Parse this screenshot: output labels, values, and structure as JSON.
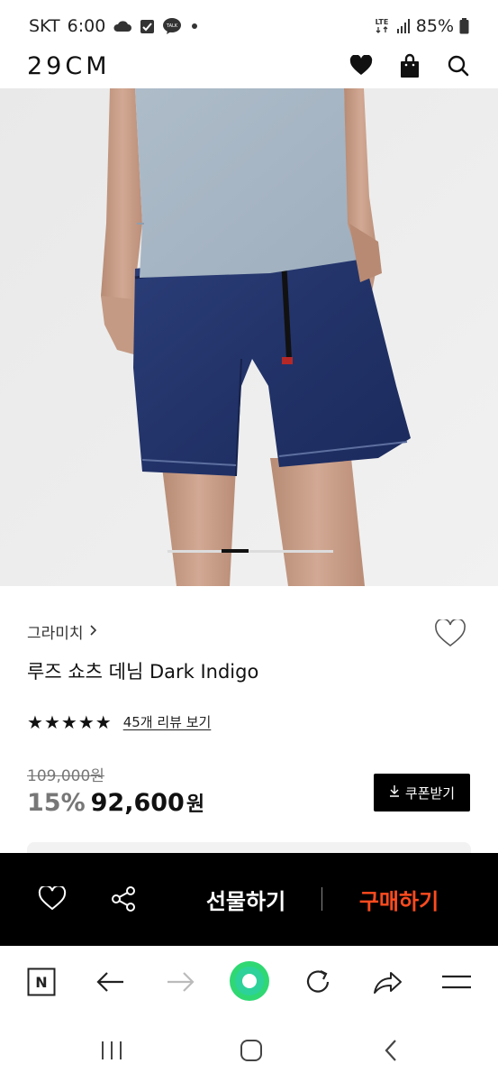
{
  "status_bar": {
    "carrier": "SKT",
    "time": "6:00",
    "network": "LTE",
    "battery": "85%",
    "talk_label": "TALK",
    "icons": [
      "cloud-icon",
      "check-box-icon",
      "talk-icon",
      "dot-icon",
      "lte-icon",
      "signal-icon",
      "battery-icon"
    ]
  },
  "header": {
    "logo": "29CM",
    "icons": [
      "heart-icon",
      "shopping-bag-icon",
      "search-icon"
    ]
  },
  "carousel": {
    "image": "product-photo-denim-shorts",
    "active_index": 1
  },
  "product": {
    "brand": "그라미치",
    "name": "루즈 쇼츠 데님 Dark Indigo",
    "rating_stars": 5,
    "review_link": "45개 리뷰 보기",
    "original_price": "109,000원",
    "discount": "15%",
    "price": "92,600",
    "currency": "원",
    "coupon_button": "쿠폰받기"
  },
  "purchase_bar": {
    "gift_label": "선물하기",
    "buy_label": "구매하기",
    "buy_color": "#ff4b1f"
  },
  "browser_bar": {
    "n_label": "N",
    "icons": [
      "naver-n-icon",
      "back-arrow-icon",
      "forward-arrow-icon",
      "home-circle-icon",
      "refresh-icon",
      "share-arrow-icon",
      "menu-icon"
    ],
    "accent": "#2fd873"
  },
  "system_nav": {
    "icons": [
      "recent-apps-icon",
      "home-icon",
      "back-icon"
    ]
  }
}
